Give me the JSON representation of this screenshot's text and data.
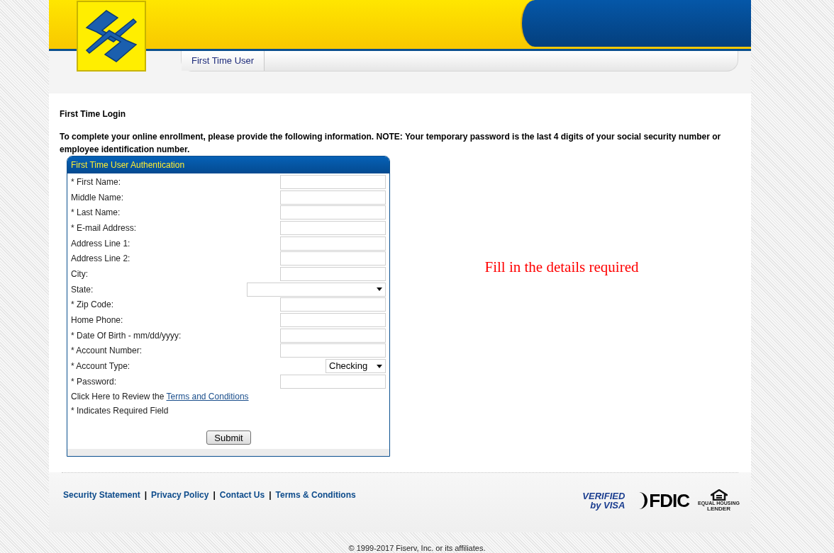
{
  "nav": {
    "tabs": [
      {
        "label": "First Time User",
        "selected": true
      }
    ]
  },
  "page": {
    "heading": "First Time Login",
    "intro": "To complete your online enrollment, please provide the following information. NOTE: Your temporary password is the last 4 digits of your social security number or employee identification number."
  },
  "form": {
    "title": "First Time User Authentication",
    "fields": [
      {
        "label": "* First Name:",
        "kind": "text"
      },
      {
        "label": "Middle Name:",
        "kind": "text"
      },
      {
        "label": "* Last Name:",
        "kind": "text"
      },
      {
        "label": "* E-mail Address:",
        "kind": "text"
      },
      {
        "label": "Address Line 1:",
        "kind": "text"
      },
      {
        "label": "Address Line 2:",
        "kind": "text"
      },
      {
        "label": "City:",
        "kind": "text"
      },
      {
        "label": "State:",
        "kind": "select-wide"
      },
      {
        "label": "* Zip Code:",
        "kind": "text"
      },
      {
        "label": "Home Phone:",
        "kind": "text"
      },
      {
        "label": "* Date Of Birth - mm/dd/yyyy:",
        "kind": "text"
      },
      {
        "label": "* Account Number:",
        "kind": "text"
      },
      {
        "label": "* Account Type:",
        "kind": "select",
        "value": "Checking"
      },
      {
        "label": "* Password:",
        "kind": "password"
      }
    ],
    "terms_text": "Click Here to Review the",
    "terms_link": "Terms and Conditions",
    "required_note": "* Indicates Required Field",
    "submit": "Submit"
  },
  "annotation": "Fill in the details required",
  "footer": {
    "links": [
      "Security Statement",
      "Privacy Policy",
      "Contact Us",
      "Terms & Conditions"
    ],
    "separator": "|",
    "badges": {
      "visa_top": "VERIFIED",
      "visa_bottom": "by VISA",
      "fdic": "FDIC",
      "housing_top": "EQUAL HOUSING",
      "housing_bottom": "LENDER"
    },
    "copyright": "© 1999-2017 Fiserv, Inc. or its affiliates."
  }
}
